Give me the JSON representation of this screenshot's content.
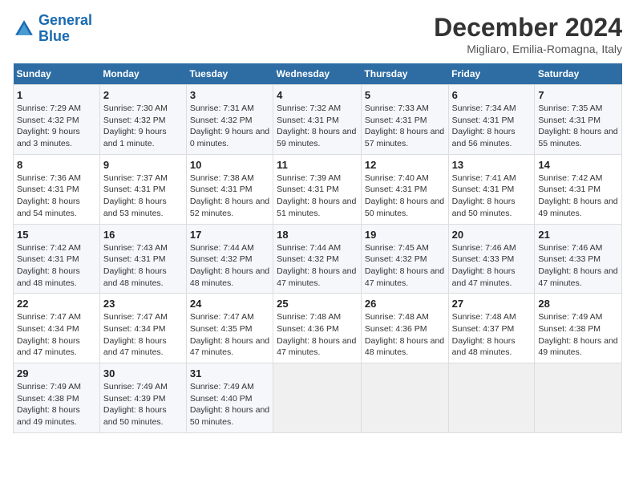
{
  "header": {
    "logo_line1": "General",
    "logo_line2": "Blue",
    "month": "December 2024",
    "location": "Migliaro, Emilia-Romagna, Italy"
  },
  "columns": [
    "Sunday",
    "Monday",
    "Tuesday",
    "Wednesday",
    "Thursday",
    "Friday",
    "Saturday"
  ],
  "weeks": [
    [
      {
        "day": "1",
        "rise": "Sunrise: 7:29 AM",
        "set": "Sunset: 4:32 PM",
        "daylight": "Daylight: 9 hours and 3 minutes."
      },
      {
        "day": "2",
        "rise": "Sunrise: 7:30 AM",
        "set": "Sunset: 4:32 PM",
        "daylight": "Daylight: 9 hours and 1 minute."
      },
      {
        "day": "3",
        "rise": "Sunrise: 7:31 AM",
        "set": "Sunset: 4:32 PM",
        "daylight": "Daylight: 9 hours and 0 minutes."
      },
      {
        "day": "4",
        "rise": "Sunrise: 7:32 AM",
        "set": "Sunset: 4:31 PM",
        "daylight": "Daylight: 8 hours and 59 minutes."
      },
      {
        "day": "5",
        "rise": "Sunrise: 7:33 AM",
        "set": "Sunset: 4:31 PM",
        "daylight": "Daylight: 8 hours and 57 minutes."
      },
      {
        "day": "6",
        "rise": "Sunrise: 7:34 AM",
        "set": "Sunset: 4:31 PM",
        "daylight": "Daylight: 8 hours and 56 minutes."
      },
      {
        "day": "7",
        "rise": "Sunrise: 7:35 AM",
        "set": "Sunset: 4:31 PM",
        "daylight": "Daylight: 8 hours and 55 minutes."
      }
    ],
    [
      {
        "day": "8",
        "rise": "Sunrise: 7:36 AM",
        "set": "Sunset: 4:31 PM",
        "daylight": "Daylight: 8 hours and 54 minutes."
      },
      {
        "day": "9",
        "rise": "Sunrise: 7:37 AM",
        "set": "Sunset: 4:31 PM",
        "daylight": "Daylight: 8 hours and 53 minutes."
      },
      {
        "day": "10",
        "rise": "Sunrise: 7:38 AM",
        "set": "Sunset: 4:31 PM",
        "daylight": "Daylight: 8 hours and 52 minutes."
      },
      {
        "day": "11",
        "rise": "Sunrise: 7:39 AM",
        "set": "Sunset: 4:31 PM",
        "daylight": "Daylight: 8 hours and 51 minutes."
      },
      {
        "day": "12",
        "rise": "Sunrise: 7:40 AM",
        "set": "Sunset: 4:31 PM",
        "daylight": "Daylight: 8 hours and 50 minutes."
      },
      {
        "day": "13",
        "rise": "Sunrise: 7:41 AM",
        "set": "Sunset: 4:31 PM",
        "daylight": "Daylight: 8 hours and 50 minutes."
      },
      {
        "day": "14",
        "rise": "Sunrise: 7:42 AM",
        "set": "Sunset: 4:31 PM",
        "daylight": "Daylight: 8 hours and 49 minutes."
      }
    ],
    [
      {
        "day": "15",
        "rise": "Sunrise: 7:42 AM",
        "set": "Sunset: 4:31 PM",
        "daylight": "Daylight: 8 hours and 48 minutes."
      },
      {
        "day": "16",
        "rise": "Sunrise: 7:43 AM",
        "set": "Sunset: 4:31 PM",
        "daylight": "Daylight: 8 hours and 48 minutes."
      },
      {
        "day": "17",
        "rise": "Sunrise: 7:44 AM",
        "set": "Sunset: 4:32 PM",
        "daylight": "Daylight: 8 hours and 48 minutes."
      },
      {
        "day": "18",
        "rise": "Sunrise: 7:44 AM",
        "set": "Sunset: 4:32 PM",
        "daylight": "Daylight: 8 hours and 47 minutes."
      },
      {
        "day": "19",
        "rise": "Sunrise: 7:45 AM",
        "set": "Sunset: 4:32 PM",
        "daylight": "Daylight: 8 hours and 47 minutes."
      },
      {
        "day": "20",
        "rise": "Sunrise: 7:46 AM",
        "set": "Sunset: 4:33 PM",
        "daylight": "Daylight: 8 hours and 47 minutes."
      },
      {
        "day": "21",
        "rise": "Sunrise: 7:46 AM",
        "set": "Sunset: 4:33 PM",
        "daylight": "Daylight: 8 hours and 47 minutes."
      }
    ],
    [
      {
        "day": "22",
        "rise": "Sunrise: 7:47 AM",
        "set": "Sunset: 4:34 PM",
        "daylight": "Daylight: 8 hours and 47 minutes."
      },
      {
        "day": "23",
        "rise": "Sunrise: 7:47 AM",
        "set": "Sunset: 4:34 PM",
        "daylight": "Daylight: 8 hours and 47 minutes."
      },
      {
        "day": "24",
        "rise": "Sunrise: 7:47 AM",
        "set": "Sunset: 4:35 PM",
        "daylight": "Daylight: 8 hours and 47 minutes."
      },
      {
        "day": "25",
        "rise": "Sunrise: 7:48 AM",
        "set": "Sunset: 4:36 PM",
        "daylight": "Daylight: 8 hours and 47 minutes."
      },
      {
        "day": "26",
        "rise": "Sunrise: 7:48 AM",
        "set": "Sunset: 4:36 PM",
        "daylight": "Daylight: 8 hours and 48 minutes."
      },
      {
        "day": "27",
        "rise": "Sunrise: 7:48 AM",
        "set": "Sunset: 4:37 PM",
        "daylight": "Daylight: 8 hours and 48 minutes."
      },
      {
        "day": "28",
        "rise": "Sunrise: 7:49 AM",
        "set": "Sunset: 4:38 PM",
        "daylight": "Daylight: 8 hours and 49 minutes."
      }
    ],
    [
      {
        "day": "29",
        "rise": "Sunrise: 7:49 AM",
        "set": "Sunset: 4:38 PM",
        "daylight": "Daylight: 8 hours and 49 minutes."
      },
      {
        "day": "30",
        "rise": "Sunrise: 7:49 AM",
        "set": "Sunset: 4:39 PM",
        "daylight": "Daylight: 8 hours and 50 minutes."
      },
      {
        "day": "31",
        "rise": "Sunrise: 7:49 AM",
        "set": "Sunset: 4:40 PM",
        "daylight": "Daylight: 8 hours and 50 minutes."
      },
      null,
      null,
      null,
      null
    ]
  ]
}
